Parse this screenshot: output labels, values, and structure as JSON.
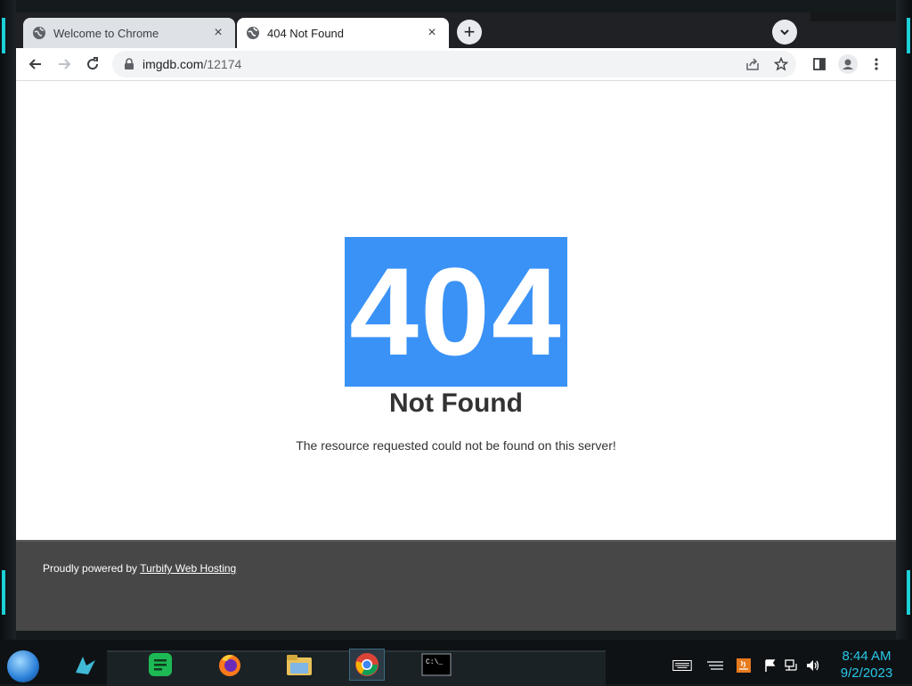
{
  "browser": {
    "tabs": [
      {
        "title": "Welcome to Chrome",
        "active": false
      },
      {
        "title": "404 Not Found",
        "active": true
      }
    ],
    "new_tab_label": "+",
    "address": {
      "domain": "imgdb.com",
      "path": "/12174"
    }
  },
  "page": {
    "code": "404",
    "title": "Not Found",
    "message": "The resource requested could not be found on this server!",
    "footer_prefix": "Proudly powered by ",
    "footer_link": "Turbify Web Hosting",
    "colors": {
      "accent": "#3a92f6",
      "footer_bg": "#474747"
    }
  },
  "taskbar": {
    "apps": [
      "spotify-icon",
      "firefox-icon",
      "file-explorer-icon",
      "chrome-icon",
      "terminal-icon"
    ],
    "active_app": "chrome-icon",
    "clock_time": "8:44 AM",
    "clock_date": "9/2/2023"
  }
}
